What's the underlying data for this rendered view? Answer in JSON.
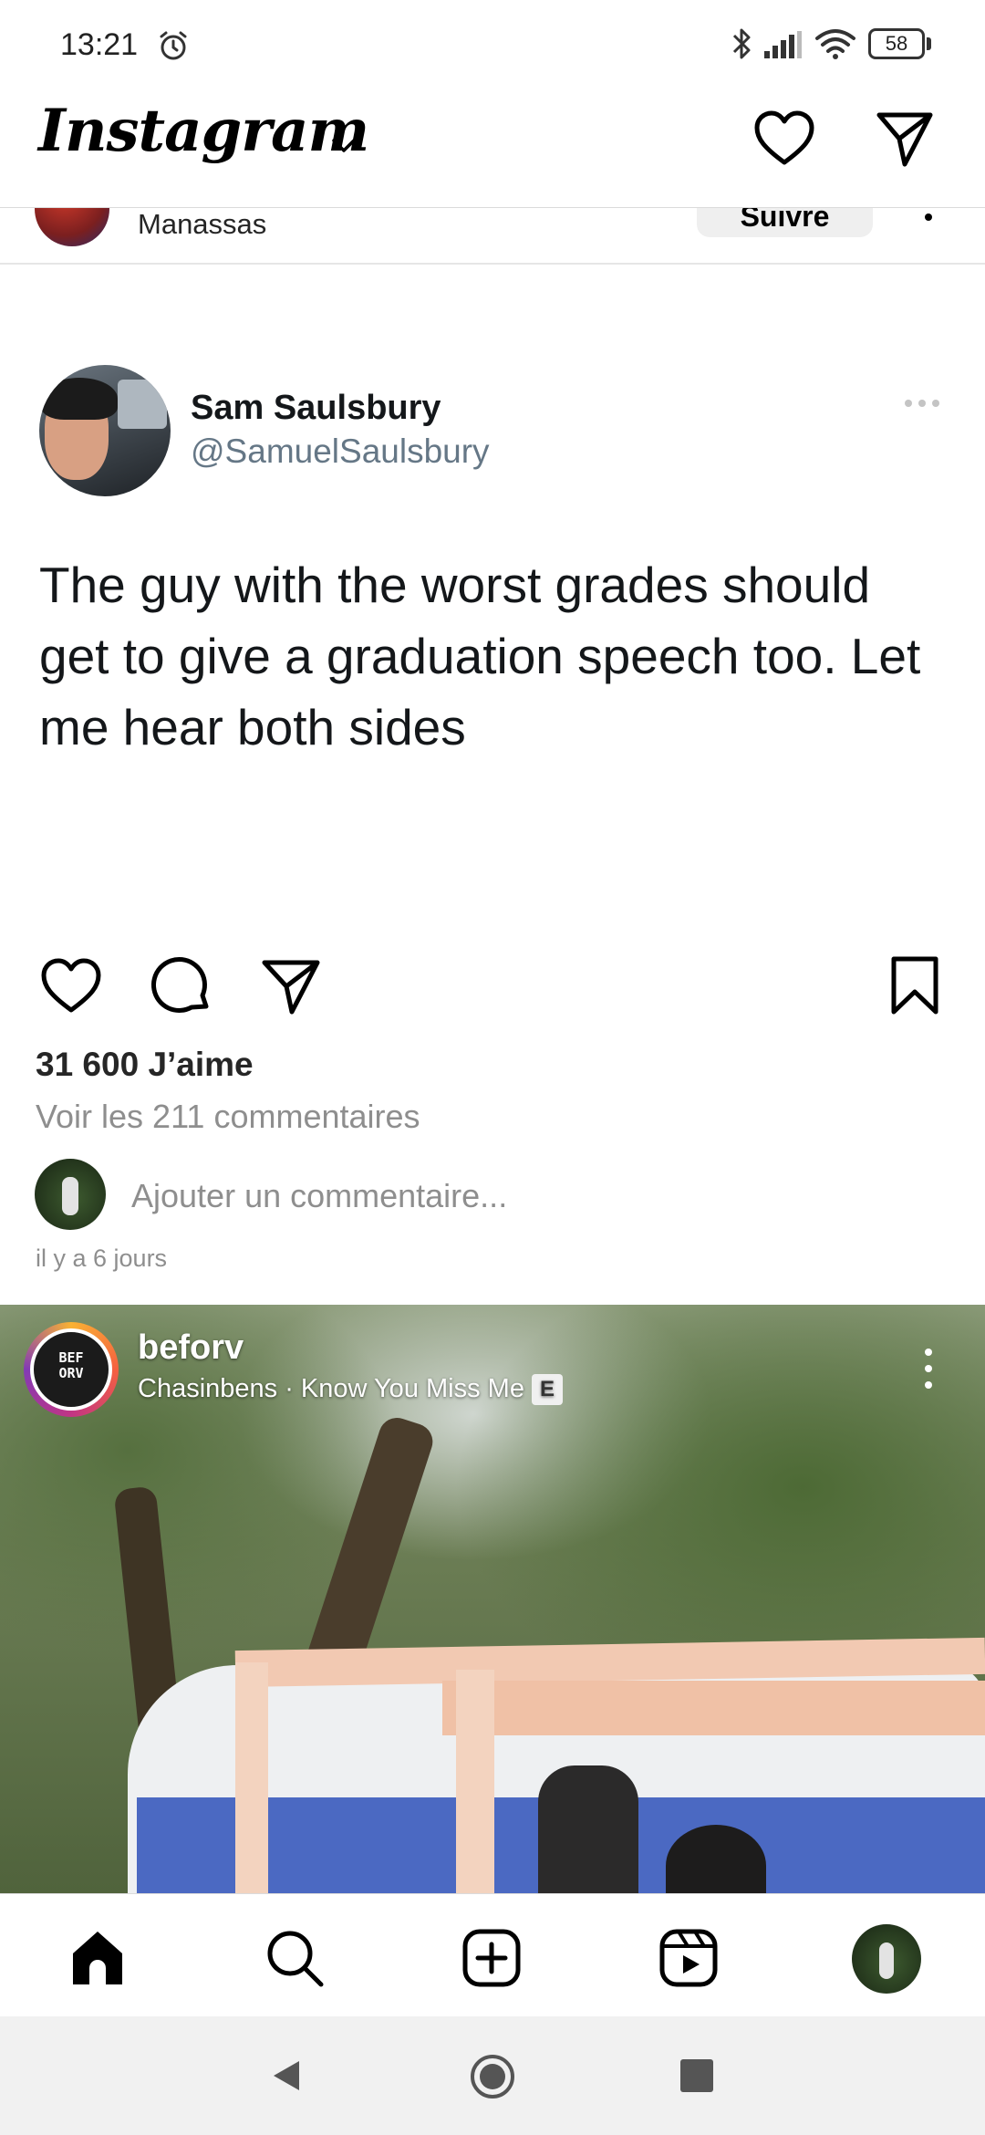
{
  "status_bar": {
    "time": "13:21",
    "battery": "58",
    "icons": [
      "alarm-icon",
      "bluetooth-icon",
      "signal-icon",
      "wifi-icon",
      "battery-icon"
    ]
  },
  "header": {
    "logo": "Instagram",
    "icons": [
      "chevron-down-icon",
      "heart-icon",
      "send-icon"
    ]
  },
  "previous_post": {
    "location": "Manassas",
    "follow_label": "Suivre"
  },
  "tweet": {
    "name": "Sam Saulsbury",
    "handle": "@SamuelSaulsbury",
    "text": "The guy with the worst grades should get to give a graduation speech too. Let me hear both sides"
  },
  "post": {
    "likes": "31 600 J’aime",
    "view_comments": "Voir les 211 commentaires",
    "add_comment_placeholder": "Ajouter un commentaire...",
    "timestamp": "il y a 6 jours",
    "actions": [
      "heart-icon",
      "comment-icon",
      "send-icon",
      "bookmark-icon"
    ]
  },
  "reel": {
    "username": "beforv",
    "audio": "Chasinbens · Know You Miss Me",
    "explicit_badge": "E",
    "avatar_text_line1": "BEF",
    "avatar_text_line2": "ORV"
  },
  "tab_bar": {
    "items": [
      "home-icon",
      "search-icon",
      "create-icon",
      "reels-icon",
      "profile-avatar"
    ]
  },
  "colors": {
    "text_primary": "#262626",
    "text_secondary": "#8e8e8e",
    "tweet_handle": "#657786",
    "divider": "#dbdbdb"
  }
}
